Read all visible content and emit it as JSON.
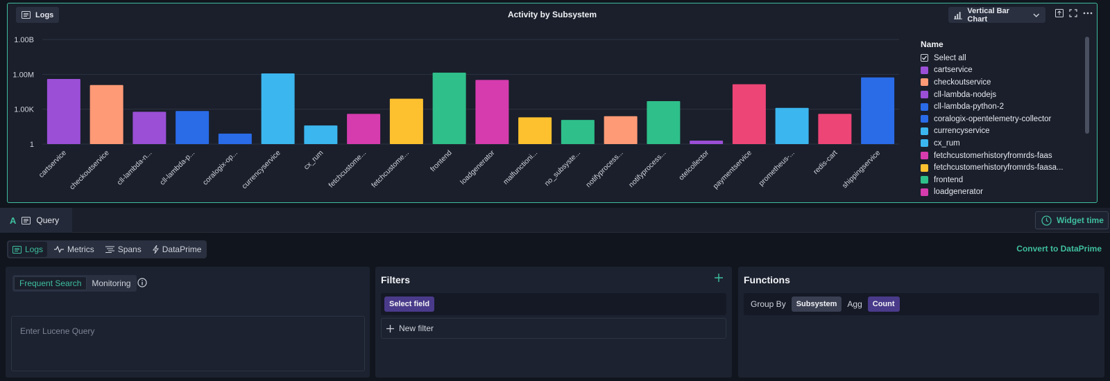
{
  "widget": {
    "logs_chip": "Logs",
    "title": "Activity by Subsystem",
    "chart_type_label": "Vertical Bar Chart",
    "icons": [
      "bar-chart-icon",
      "chevron-down-icon",
      "export-icon",
      "fullscreen-icon",
      "more-icon"
    ]
  },
  "chart_data": {
    "type": "bar",
    "y_scale": "log",
    "y_ticks": [
      "1.00B",
      "1.00M",
      "1.00K",
      "1"
    ],
    "ylim": [
      1,
      1000000000
    ],
    "grid": true,
    "legend_placement": "right",
    "categories": [
      "cartservice",
      "checkoutservice",
      "cll-lambda-n...",
      "cll-lambda-p...",
      "coralogix-op...",
      "currencyservice",
      "cx_rum",
      "fetchcustome...",
      "fetchcustome...",
      "frontend",
      "loadgenerator",
      "malfunctioni...",
      "no_subsyste...",
      "notifyprocess...",
      "notifyprocess...",
      "otelcollector",
      "paymentservice",
      "prometheus-...",
      "redis-cart",
      "shippingservice"
    ],
    "values": [
      400000,
      120000,
      600,
      700,
      8,
      1200000,
      40,
      400,
      8000,
      1400000,
      330000,
      200,
      120,
      250,
      5000,
      2,
      140000,
      1300,
      400,
      550000
    ],
    "colors": [
      "#9b4fd6",
      "#ff9a76",
      "#9b4fd6",
      "#2a6be8",
      "#2a6be8",
      "#3bb6ee",
      "#3bb6ee",
      "#d63cae",
      "#fdc12f",
      "#2fbf8a",
      "#d63cae",
      "#fdc12f",
      "#2fbf8a",
      "#ff9a76",
      "#2fbf8a",
      "#9b4fd6",
      "#ee4577",
      "#3bb6ee",
      "#ee4577",
      "#2a6be8"
    ],
    "legend": {
      "title": "Name",
      "select_all": "Select all",
      "items": [
        {
          "name": "cartservice",
          "color": "#9b4fd6"
        },
        {
          "name": "checkoutservice",
          "color": "#ff9a76"
        },
        {
          "name": "cll-lambda-nodejs",
          "color": "#9b4fd6"
        },
        {
          "name": "cll-lambda-python-2",
          "color": "#2a6be8"
        },
        {
          "name": "coralogix-opentelemetry-collector",
          "color": "#2a6be8"
        },
        {
          "name": "currencyservice",
          "color": "#3bb6ee"
        },
        {
          "name": "cx_rum",
          "color": "#3bb6ee"
        },
        {
          "name": "fetchcustomerhistoryfromrds-faas",
          "color": "#d63cae"
        },
        {
          "name": "fetchcustomerhistoryfromrds-faasa...",
          "color": "#fdc12f"
        },
        {
          "name": "frontend",
          "color": "#2fbf8a"
        },
        {
          "name": "loadgenerator",
          "color": "#d63cae"
        }
      ]
    }
  },
  "query": {
    "tab_letter": "A",
    "tab_label": "Query",
    "widget_time": "Widget time",
    "sources": [
      "Logs",
      "Metrics",
      "Spans",
      "DataPrime"
    ],
    "active_source": "Logs",
    "convert_label": "Convert to DataPrime"
  },
  "search_panel": {
    "modes": [
      "Frequent Search",
      "Monitoring"
    ],
    "active_mode": "Frequent Search",
    "placeholder": "Enter Lucene Query"
  },
  "filters_panel": {
    "title": "Filters",
    "select_field": "Select field",
    "new_filter": "New filter"
  },
  "functions_panel": {
    "title": "Functions",
    "group_by_label": "Group By",
    "group_by_value": "Subsystem",
    "agg_label": "Agg",
    "agg_value": "Count"
  },
  "colors": {
    "accent": "#3fbf9f",
    "background": "#11151d",
    "panel": "#1c2230",
    "pill": "#4a3a8a"
  }
}
